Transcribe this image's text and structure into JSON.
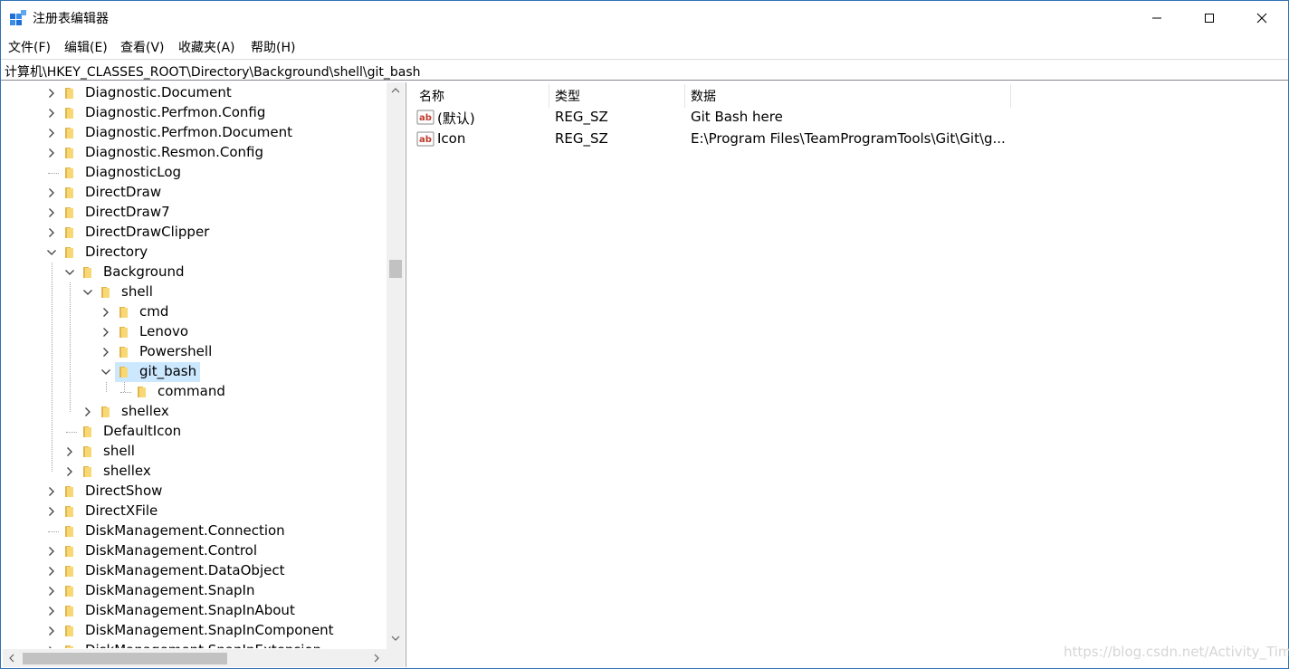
{
  "window": {
    "title": "注册表编辑器",
    "controls": {
      "minimize": "minimize",
      "maximize": "maximize",
      "close": "close"
    }
  },
  "menu": [
    {
      "label": "文件(F)"
    },
    {
      "label": "编辑(E)"
    },
    {
      "label": "查看(V)"
    },
    {
      "label": "收藏夹(A)"
    },
    {
      "label": "帮助(H)"
    }
  ],
  "address": {
    "path": "计算机\\HKEY_CLASSES_ROOT\\Directory\\Background\\shell\\git_bash"
  },
  "tree": {
    "items": [
      {
        "label": "Diagnostic.Document",
        "level": 0,
        "expander": "collapsed"
      },
      {
        "label": "Diagnostic.Perfmon.Config",
        "level": 0,
        "expander": "collapsed"
      },
      {
        "label": "Diagnostic.Perfmon.Document",
        "level": 0,
        "expander": "collapsed"
      },
      {
        "label": "Diagnostic.Resmon.Config",
        "level": 0,
        "expander": "collapsed"
      },
      {
        "label": "DiagnosticLog",
        "level": 0,
        "expander": "none"
      },
      {
        "label": "DirectDraw",
        "level": 0,
        "expander": "collapsed"
      },
      {
        "label": "DirectDraw7",
        "level": 0,
        "expander": "collapsed"
      },
      {
        "label": "DirectDrawClipper",
        "level": 0,
        "expander": "collapsed"
      },
      {
        "label": "Directory",
        "level": 0,
        "expander": "expanded"
      },
      {
        "label": "Background",
        "level": 1,
        "expander": "expanded"
      },
      {
        "label": "shell",
        "level": 2,
        "expander": "expanded"
      },
      {
        "label": "cmd",
        "level": 3,
        "expander": "collapsed"
      },
      {
        "label": "Lenovo",
        "level": 3,
        "expander": "collapsed"
      },
      {
        "label": "Powershell",
        "level": 3,
        "expander": "collapsed"
      },
      {
        "label": "git_bash",
        "level": 3,
        "expander": "expanded",
        "selected": true
      },
      {
        "label": "command",
        "level": 4,
        "expander": "none"
      },
      {
        "label": "shellex",
        "level": 2,
        "expander": "collapsed"
      },
      {
        "label": "DefaultIcon",
        "level": 1,
        "expander": "none"
      },
      {
        "label": "shell",
        "level": 1,
        "expander": "collapsed"
      },
      {
        "label": "shellex",
        "level": 1,
        "expander": "collapsed"
      },
      {
        "label": "DirectShow",
        "level": 0,
        "expander": "collapsed"
      },
      {
        "label": "DirectXFile",
        "level": 0,
        "expander": "collapsed"
      },
      {
        "label": "DiskManagement.Connection",
        "level": 0,
        "expander": "none"
      },
      {
        "label": "DiskManagement.Control",
        "level": 0,
        "expander": "collapsed"
      },
      {
        "label": "DiskManagement.DataObject",
        "level": 0,
        "expander": "collapsed"
      },
      {
        "label": "DiskManagement.SnapIn",
        "level": 0,
        "expander": "collapsed"
      },
      {
        "label": "DiskManagement.SnapInAbout",
        "level": 0,
        "expander": "collapsed"
      },
      {
        "label": "DiskManagement.SnapInComponent",
        "level": 0,
        "expander": "collapsed"
      },
      {
        "label": "DiskManagement.SnapInExtension",
        "level": 0,
        "expander": "collapsed"
      }
    ]
  },
  "values": {
    "columns": [
      "名称",
      "类型",
      "数据"
    ],
    "rows": [
      {
        "name": "(默认)",
        "type": "REG_SZ",
        "data": "Git Bash here"
      },
      {
        "name": "Icon",
        "type": "REG_SZ",
        "data": "E:\\Program Files\\TeamProgramTools\\Git\\Git\\g..."
      }
    ]
  },
  "watermark": "https://blog.csdn.net/Activity_Time",
  "colors": {
    "selection": "#cce8ff",
    "folder": "#f8d775",
    "folder_dark": "#e0b64d",
    "border": "#2f71b3"
  }
}
